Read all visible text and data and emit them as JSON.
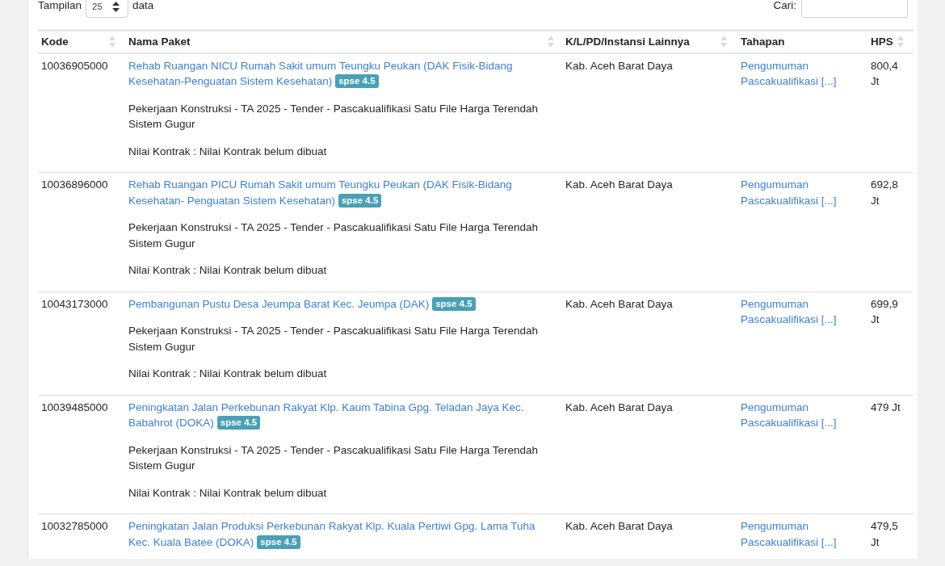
{
  "page_length": {
    "label": "Tampilan",
    "value": "25",
    "suffix": "data"
  },
  "search": {
    "label": "Cari:"
  },
  "table": {
    "columns": [
      {
        "label": "Kode",
        "sortable": true
      },
      {
        "label": "Nama Paket",
        "sortable": true
      },
      {
        "label": "K/L/PD/Instansi Lainnya",
        "sortable": true
      },
      {
        "label": "Tahapan",
        "sortable": false
      },
      {
        "label": "HPS",
        "sortable": true
      }
    ],
    "rows": [
      {
        "kode": "10036905000",
        "paket": {
          "title": "Rehab Ruangan NICU Rumah Sakit umum Teungku Peukan (DAK Fisik-Bidang Kesehatan-Penguatan Sistem Kesehatan)",
          "badge": "spse 4.5",
          "jenis": "Pekerjaan Konstruksi - TA 2025 - Tender - Pascakualifikasi Satu File Harga Terendah Sistem Gugur",
          "nilai": "Nilai Kontrak : Nilai Kontrak belum dibuat"
        },
        "instansi": "Kab. Aceh Barat Daya",
        "tahapan": "Pengumuman Pascakualifikasi [...]",
        "hps": "800,4 Jt"
      },
      {
        "kode": "10036896000",
        "paket": {
          "title": "Rehab Ruangan PICU Rumah Sakit umum Teungku Peukan (DAK Fisik-Bidang Kesehatan- Penguatan Sistem Kesehatan)",
          "badge": "spse 4.5",
          "jenis": "Pekerjaan Konstruksi - TA 2025 - Tender - Pascakualifikasi Satu File Harga Terendah Sistem Gugur",
          "nilai": "Nilai Kontrak : Nilai Kontrak belum dibuat"
        },
        "instansi": "Kab. Aceh Barat Daya",
        "tahapan": "Pengumuman Pascakualifikasi [...]",
        "hps": "692,8 Jt"
      },
      {
        "kode": "10043173000",
        "paket": {
          "title": "Pembangunan Pustu Desa Jeumpa Barat Kec. Jeumpa (DAK)",
          "badge": "spse 4.5",
          "jenis": "Pekerjaan Konstruksi - TA 2025 - Tender - Pascakualifikasi Satu File Harga Terendah Sistem Gugur",
          "nilai": "Nilai Kontrak : Nilai Kontrak belum dibuat"
        },
        "instansi": "Kab. Aceh Barat Daya",
        "tahapan": "Pengumuman Pascakualifikasi [...]",
        "hps": "699,9 Jt"
      },
      {
        "kode": "10039485000",
        "paket": {
          "title": "Peningkatan Jalan Perkebunan Rakyat Klp. Kaum Tabina Gpg. Teladan Jaya Kec. Babahrot (DOKA)",
          "badge": "spse 4.5",
          "jenis": "Pekerjaan Konstruksi - TA 2025 - Tender - Pascakualifikasi Satu File Harga Terendah Sistem Gugur",
          "nilai": "Nilai Kontrak : Nilai Kontrak belum dibuat"
        },
        "instansi": "Kab. Aceh Barat Daya",
        "tahapan": "Pengumuman Pascakualifikasi [...]",
        "hps": "479 Jt"
      },
      {
        "kode": "10032785000",
        "paket": {
          "title": "Peningkatan Jalan Produksi Perkebunan Rakyat Klp. Kuala Pertiwi Gpg. Lama Tuha Kec. Kuala Batee (DOKA)",
          "badge": "spse 4.5"
        },
        "instansi": "Kab. Aceh Barat Daya",
        "tahapan": "Pengumuman Pascakualifikasi [...]",
        "hps": "479,5 Jt"
      }
    ]
  }
}
